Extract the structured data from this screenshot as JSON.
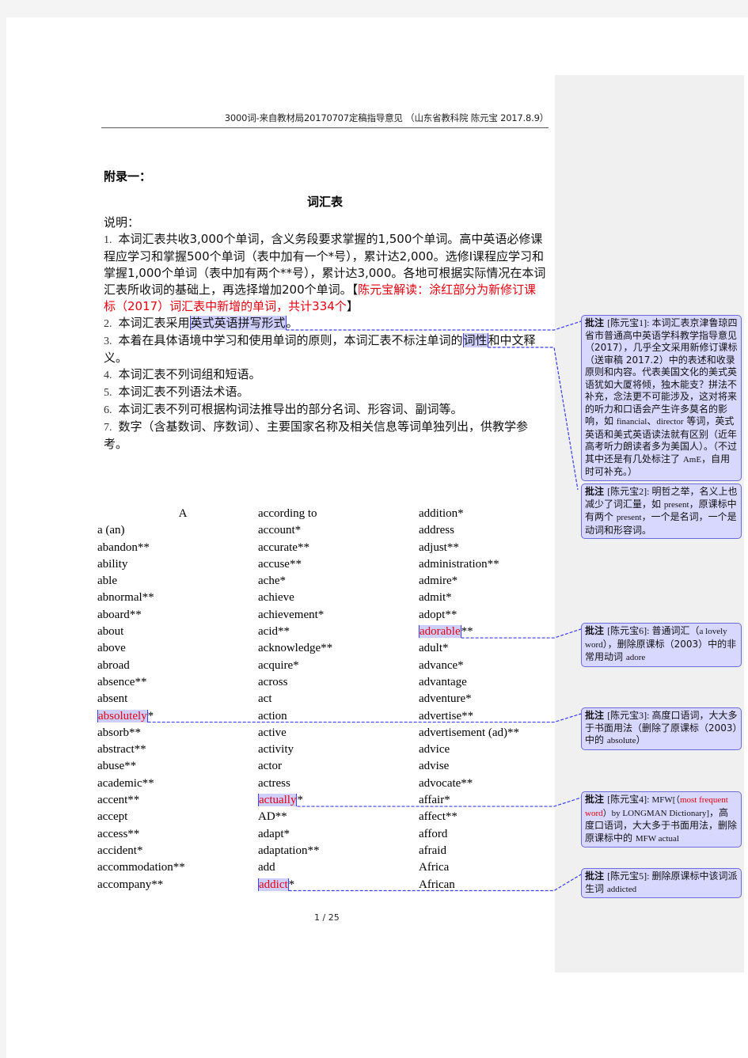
{
  "header": {
    "text": "3000词-来自教材局20170707定稿指导意见 （山东省教科院 陈元宝 2017.8.9）"
  },
  "appendix_label": "附录一：",
  "title": "词汇表",
  "intro": {
    "label": "说明：",
    "items": [
      {
        "num": "1.",
        "text": "本词汇表共收3,000个单词，含义务段要求掌握的1,500个单词。高中英语必修课程应学习和掌握500个单词（表中加有一个*号），累计达2,000。选修Ⅰ课程应学习和掌握1,000个单词（表中加有两个**号），累计达3,000。各地可根据实际情况在本词汇表所收词的基础上，再选择增加200个单词。【",
        "red": "陈元宝解读：涂红部分为新修订课标（2017）词汇表中新增的单词，共计334个",
        "tail": "】"
      },
      {
        "num": "2.",
        "before": "本词汇表采用",
        "highlight": "英式英语拼写形式",
        "after": "。"
      },
      {
        "num": "3.",
        "before": "本着在具体语境中学习和使用单词的原则，本词汇表不标注单词的",
        "highlight": "词性",
        "after": "和中文释义。"
      },
      {
        "num": "4.",
        "text": "本词汇表不列词组和短语。"
      },
      {
        "num": "5.",
        "text": "本词汇表不列语法术语。"
      },
      {
        "num": "6.",
        "text": "本词汇表不列可根据构词法推导出的部分名词、形容词、副词等。"
      },
      {
        "num": "7.",
        "text": "数字（含基数词、序数词）、主要国家名称及相关信息等词单独列出，供教学参考。"
      }
    ]
  },
  "word_list": {
    "section_letter": "A",
    "columns": [
      [
        {
          "w": "a (an)"
        },
        {
          "w": "abandon**"
        },
        {
          "w": "ability"
        },
        {
          "w": "able"
        },
        {
          "w": "abnormal**"
        },
        {
          "w": "aboard**"
        },
        {
          "w": "about"
        },
        {
          "w": "above"
        },
        {
          "w": "abroad"
        },
        {
          "w": "absence**"
        },
        {
          "w": "absent"
        },
        {
          "w": "absolutely",
          "suffix": "*",
          "new": true
        },
        {
          "w": "absorb**"
        },
        {
          "w": "abstract**"
        },
        {
          "w": "abuse**"
        },
        {
          "w": "academic**"
        },
        {
          "w": "accent**"
        },
        {
          "w": "accept"
        },
        {
          "w": "access**"
        },
        {
          "w": "accident*"
        },
        {
          "w": "accommodation**"
        },
        {
          "w": "accompany**"
        }
      ],
      [
        {
          "w": "according to"
        },
        {
          "w": "account*"
        },
        {
          "w": "accurate**"
        },
        {
          "w": "accuse**"
        },
        {
          "w": "ache*"
        },
        {
          "w": "achieve"
        },
        {
          "w": "achievement*"
        },
        {
          "w": "acid**"
        },
        {
          "w": "acknowledge**"
        },
        {
          "w": "acquire*"
        },
        {
          "w": "across"
        },
        {
          "w": "act"
        },
        {
          "w": "action"
        },
        {
          "w": "active"
        },
        {
          "w": "activity"
        },
        {
          "w": "actor"
        },
        {
          "w": "actress"
        },
        {
          "w": "actually",
          "suffix": "*",
          "new": true
        },
        {
          "w": "AD**"
        },
        {
          "w": "adapt*"
        },
        {
          "w": "adaptation**"
        },
        {
          "w": "add"
        },
        {
          "w": "addict",
          "suffix": "*",
          "new": true
        }
      ],
      [
        {
          "w": "addition*"
        },
        {
          "w": "address"
        },
        {
          "w": "adjust**"
        },
        {
          "w": "administration**"
        },
        {
          "w": "admire*"
        },
        {
          "w": "admit*"
        },
        {
          "w": "adopt**"
        },
        {
          "w": "adorable",
          "suffix": "**",
          "new": true
        },
        {
          "w": "adult*"
        },
        {
          "w": "advance*"
        },
        {
          "w": "advantage"
        },
        {
          "w": "adventure*"
        },
        {
          "w": "advertise**"
        },
        {
          "w": "advertisement (ad)**"
        },
        {
          "w": "advice"
        },
        {
          "w": "advise"
        },
        {
          "w": "advocate**"
        },
        {
          "w": "affair*"
        },
        {
          "w": "affect**"
        },
        {
          "w": "afford"
        },
        {
          "w": "afraid"
        },
        {
          "w": "Africa"
        },
        {
          "w": "African"
        }
      ]
    ]
  },
  "page_indicator": "1 / 25",
  "comments": [
    {
      "label": "批注",
      "author": "[陈元宝1]:",
      "parts": [
        {
          "t": "本词汇表京津鲁琼四省市普通高中英语学科教学指导意见（2017），几乎全文采用新修订课标（送审稿 2017.2）中的表述和收录原则和内容。代表美国文化的美式英语犹如大厦将倾，独木能支？拼法不补充，念法更不可能涉及，这对将来的听力和口语会产生许多莫名的影响，如 "
        },
        {
          "t": "financial",
          "en": true
        },
        {
          "t": "、"
        },
        {
          "t": "director",
          "en": true
        },
        {
          "t": " 等词，英式英语和美式英语读法就有区别（近年高考听力朗读者多为美国人）。（不过其中还是有几处标注了 "
        },
        {
          "t": "AmE",
          "en": true
        },
        {
          "t": "，自用时可补充。）"
        }
      ]
    },
    {
      "label": "批注",
      "author": "[陈元宝2]:",
      "parts": [
        {
          "t": "明哲之举，名义上也减少了词汇量，如 "
        },
        {
          "t": "present",
          "en": true
        },
        {
          "t": "，原课标中有两个 "
        },
        {
          "t": "present",
          "en": true
        },
        {
          "t": "，一个是名词，一个是动词和形容词。"
        }
      ]
    },
    {
      "label": "批注",
      "author": "[陈元宝6]:",
      "parts": [
        {
          "t": "普通词汇（"
        },
        {
          "t": "a lovely word",
          "en": true
        },
        {
          "t": "），删除原课标（2003）中的非常用动词 "
        },
        {
          "t": "adore",
          "en": true
        }
      ]
    },
    {
      "label": "批注",
      "author": "[陈元宝3]:",
      "parts": [
        {
          "t": "高度口语词，大大多于书面用法（删除了原课标（2003）中的 "
        },
        {
          "t": "absolute",
          "en": true
        },
        {
          "t": "）"
        }
      ]
    },
    {
      "label": "批注",
      "author": "[陈元宝4]:",
      "parts": [
        {
          "t": "MFW[（",
          "en": true
        },
        {
          "t": "most frequent word",
          "red": true
        },
        {
          "t": "）by LONGMAN Dictionary]",
          "en": true
        },
        {
          "t": "，高度口语词，大大多于书面用法，删除原课标中的 "
        },
        {
          "t": "MFW actual",
          "en": true
        }
      ]
    },
    {
      "label": "批注",
      "author": "[陈元宝5]:",
      "parts": [
        {
          "t": "删除原课标中该词派生词 "
        },
        {
          "t": "addicted",
          "en": true
        }
      ]
    }
  ],
  "colors": {
    "new_word_red": "#e4000f",
    "highlight": "#cfcfff",
    "comment_bg": "#d8d8ff",
    "link_blue": "#3c3cf0"
  }
}
